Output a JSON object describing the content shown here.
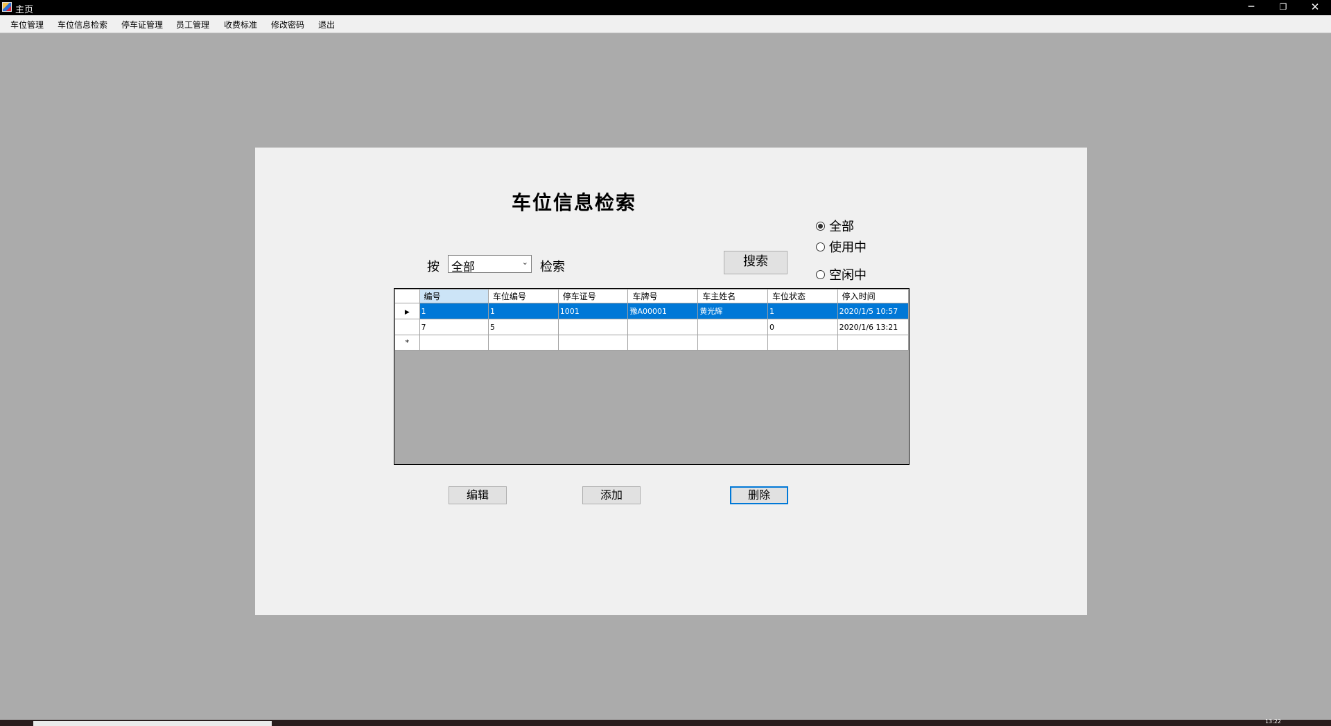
{
  "window": {
    "title": "主页",
    "minimize_glyph": "─",
    "maximize_glyph": "❐",
    "close_glyph": "✕"
  },
  "menu": [
    {
      "label": "车位管理"
    },
    {
      "label": "车位信息检索"
    },
    {
      "label": "停车证管理"
    },
    {
      "label": "员工管理"
    },
    {
      "label": "收费标准"
    },
    {
      "label": "修改密码"
    },
    {
      "label": "退出"
    }
  ],
  "form": {
    "heading": "车位信息检索",
    "by_label": "按",
    "search_suffix_label": "检索",
    "search_field": {
      "selected": "全部"
    },
    "search_button": "搜索",
    "filter": {
      "options": [
        {
          "label": "全部",
          "checked": true
        },
        {
          "label": "使用中",
          "checked": false
        },
        {
          "label": "空闲中",
          "checked": false
        }
      ]
    },
    "grid": {
      "columns": [
        "编号",
        "车位编号",
        "停车证号",
        "车牌号",
        "车主姓名",
        "车位状态",
        "停入时间"
      ],
      "rows": [
        [
          "1",
          "1",
          "1001",
          "豫A00001",
          "黄光辉",
          "1",
          "2020/1/5 10:57"
        ],
        [
          "7",
          "5",
          "",
          "",
          "",
          "0",
          "2020/1/6 13:21"
        ]
      ],
      "selected_row": 0,
      "new_row_marker": "*",
      "current_row_marker": "▶"
    },
    "buttons": {
      "edit": "编辑",
      "add": "添加",
      "delete": "删除"
    }
  },
  "taskbar": {
    "clock": "13:22"
  }
}
